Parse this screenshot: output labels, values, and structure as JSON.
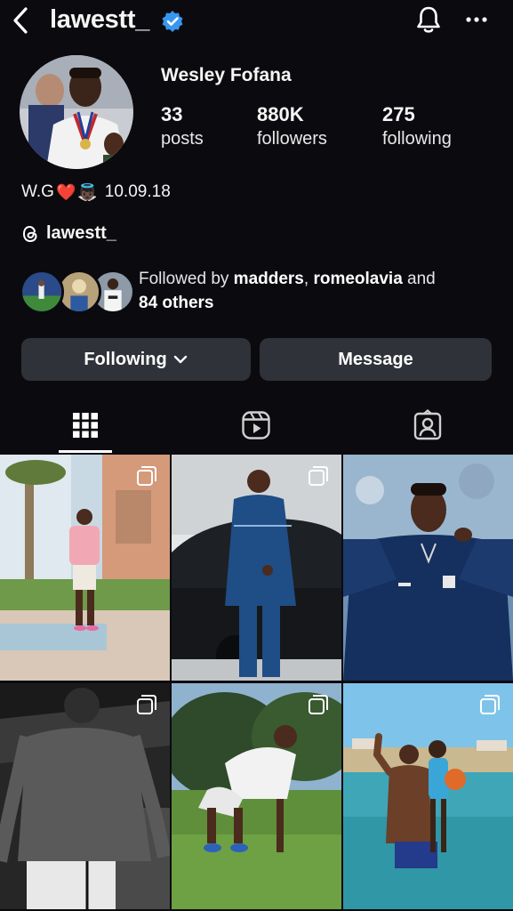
{
  "header": {
    "username": "lawestt_",
    "icons": {
      "back": "chevron-left-icon",
      "verified": "verified-badge-icon",
      "notifications": "bell-icon",
      "more": "more-horizontal-icon"
    }
  },
  "profile": {
    "display_name": "Wesley Fofana",
    "stats": [
      {
        "count": "33",
        "label": "posts"
      },
      {
        "count": "880K",
        "label": "followers"
      },
      {
        "count": "275",
        "label": "following"
      }
    ],
    "bio": {
      "text_before": "W.G",
      "emoji_1": "❤️",
      "emoji_2": "👼🏿",
      "date": "10.09.18"
    },
    "threads_handle": "lawestt_",
    "followed_by": {
      "prefix": "Followed by ",
      "user_1": "madders",
      "separator": ", ",
      "user_2": "romeolavia",
      "joiner": " and",
      "others": "84 others"
    }
  },
  "actions": {
    "following_label": "Following",
    "message_label": "Message"
  },
  "tabs": [
    {
      "name": "grid",
      "icon": "grid-icon",
      "active": true
    },
    {
      "name": "reels",
      "icon": "reels-icon",
      "active": false
    },
    {
      "name": "tagged",
      "icon": "tagged-icon",
      "active": false
    }
  ],
  "posts_grid": {
    "multi_photo_icon": "multiple-posts-icon",
    "posts": [
      {
        "type": "carousel"
      },
      {
        "type": "carousel"
      },
      {
        "type": "single"
      },
      {
        "type": "carousel"
      },
      {
        "type": "carousel"
      },
      {
        "type": "carousel"
      }
    ]
  },
  "colors": {
    "background": "#0b0b0f",
    "button": "#2f3239",
    "verified": "#3797f0",
    "text": "#f5f5f5"
  }
}
